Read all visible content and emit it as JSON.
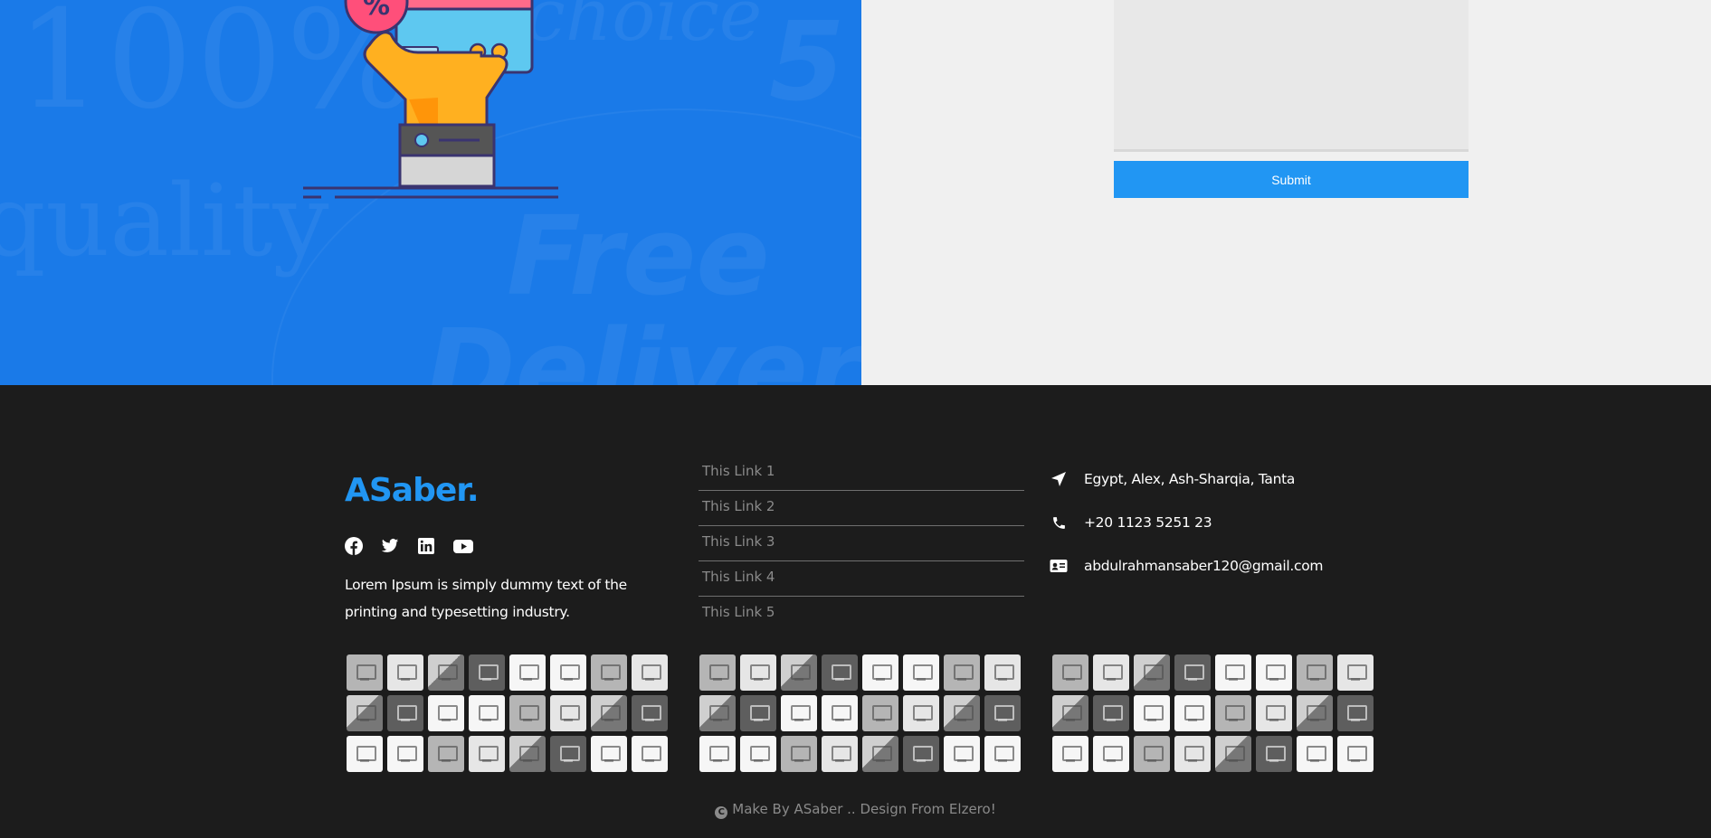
{
  "banner": {
    "bg_words": [
      "100%",
      "quality",
      "choice",
      "Free",
      "Delivery",
      "5"
    ]
  },
  "form": {
    "submit_label": "Submit"
  },
  "footer": {
    "brand": "ASaber.",
    "brand_color": "#2196f3",
    "socials": [
      {
        "icon": "facebook-icon"
      },
      {
        "icon": "twitter-icon"
      },
      {
        "icon": "linkedin-icon"
      },
      {
        "icon": "youtube-icon"
      }
    ],
    "about": "Lorem Ipsum is simply dummy text of the printing and typesetting industry.",
    "links": [
      "This Link 1",
      "This Link 2",
      "This Link 3",
      "This Link 4",
      "This Link 5"
    ],
    "contact": [
      {
        "icon": "location-arrow-icon",
        "text": "Egypt, Alex, Ash-Sharqia, Tanta"
      },
      {
        "icon": "phone-icon",
        "text": "+20 1123 5251 23"
      },
      {
        "icon": "contact-card-icon",
        "text": "abdulrahmansaber120@gmail.com"
      }
    ],
    "copyright_icon": "C",
    "copyright": "Make By ASaber .. Design From Elzero!"
  }
}
